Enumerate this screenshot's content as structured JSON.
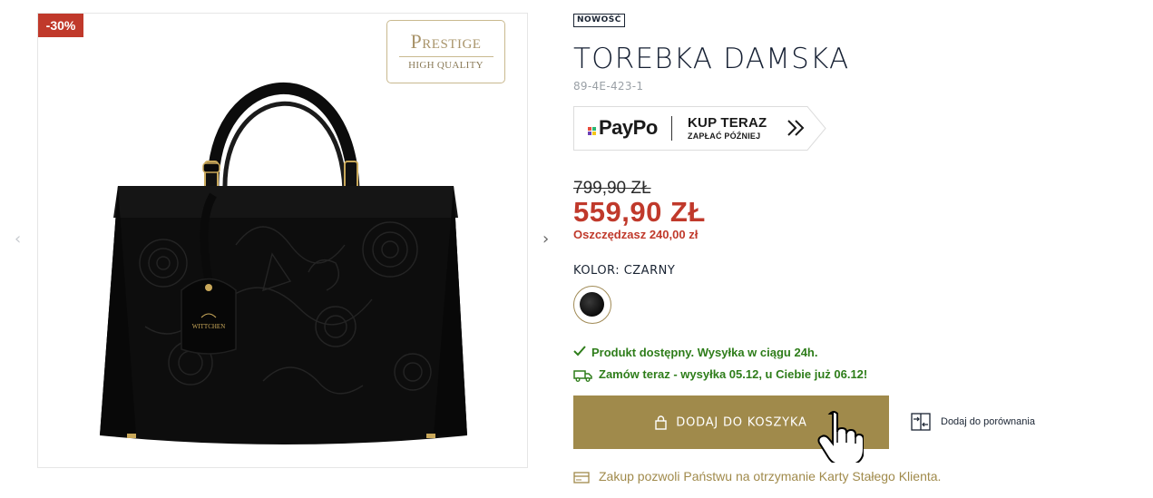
{
  "gallery": {
    "discount_badge": "-30%",
    "prestige_title": "Prestige",
    "prestige_subtitle": "HIGH QUALITY",
    "arrow_left": "‹",
    "arrow_right": "›"
  },
  "product": {
    "badge_new": "NOWOŚĆ",
    "title": "TOREBKA DAMSKA",
    "sku": "89-4E-423-1"
  },
  "paypo": {
    "logo": "PayPo",
    "cta_main": "KUP TERAZ",
    "cta_sub": "ZAPŁAĆ PÓŹNIEJ",
    "dot_colors": [
      "#e94b3c",
      "#2bb673",
      "#6c3fb5",
      "#f5c518"
    ]
  },
  "price": {
    "old": "799,90 ZŁ",
    "new": "559,90 ZŁ",
    "savings": "Oszczędzasz 240,00 zł"
  },
  "color": {
    "label": "KOLOR: CZARNY",
    "selected": "czarny"
  },
  "availability": {
    "status": "Produkt dostępny. Wysyłka w ciągu 24h.",
    "shipping": "Zamów teraz - wysyłka 05.12, u Ciebie już 06.12!"
  },
  "actions": {
    "add_to_cart": "DODAJ DO KOSZYKA",
    "compare": "Dodaj do porównania"
  },
  "loyalty": {
    "text": "Zakup pozwoli Państwu na otrzymanie Karty Stałego Klienta."
  },
  "colors": {
    "accent_gold": "#a08a4b",
    "price_red": "#c0392b",
    "success_green": "#2e7d1a",
    "text_dark": "#1a2433"
  },
  "icons": [
    "lock-icon",
    "check-icon",
    "truck-icon",
    "compare-icon",
    "card-icon",
    "hand-cursor-icon",
    "chevron-left-icon",
    "chevron-right-icon",
    "double-chevron-icon"
  ]
}
